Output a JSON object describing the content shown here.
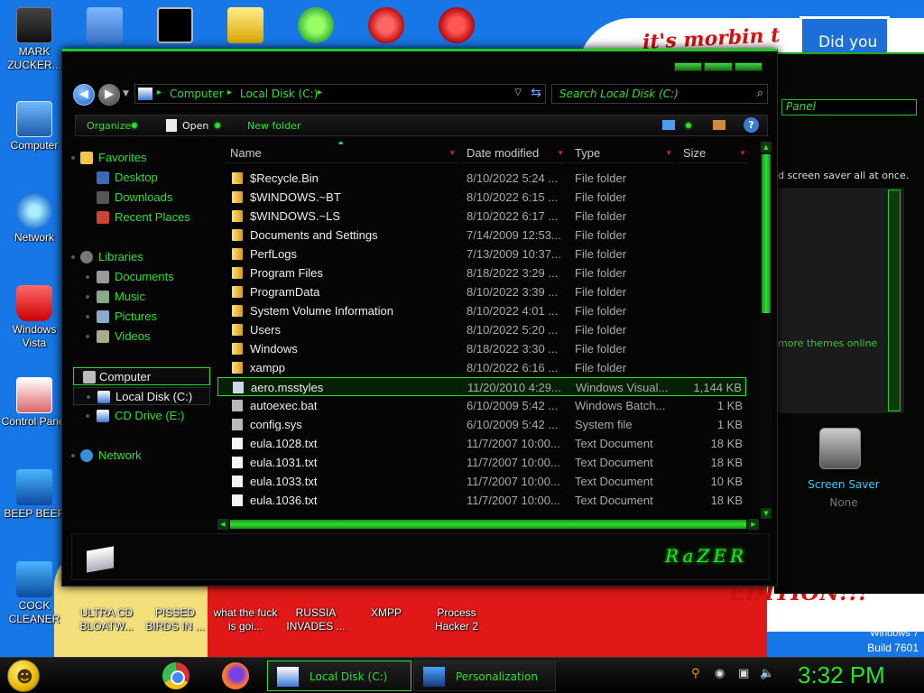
{
  "desktop": {
    "wallpaper_text_1": "it's morbin t",
    "wallpaper_text_2": "EDITION!!!",
    "wallpaper_didyou": "Did you",
    "build_line1": "Windows 7",
    "build_line2": "Build 7601",
    "icons_left": [
      {
        "label": "MARK ZUCKER..."
      },
      {
        "label": "Computer"
      },
      {
        "label": "Network"
      },
      {
        "label": "Windows Vista"
      },
      {
        "label": "Control Panel"
      },
      {
        "label": "BEEP BEEP"
      },
      {
        "label": "COCK CLEANER"
      }
    ],
    "icons_bottom": [
      {
        "label": "ULTRA CD BLOATW..."
      },
      {
        "label": "PISSED BIRDS IN ..."
      },
      {
        "label": "what the fuck is goi..."
      },
      {
        "label": "RUSSIA INVADES ..."
      },
      {
        "label": "XMPP"
      },
      {
        "label": "Process Hacker 2"
      }
    ],
    "icons_top": [
      {
        "label": "command-prompt-icon"
      },
      {
        "label": "notepad-icon"
      },
      {
        "label": "folder-icon"
      },
      {
        "label": "pissed-birds-icon"
      },
      {
        "label": "p-icon"
      },
      {
        "label": "DEV C++"
      }
    ]
  },
  "bg_window": {
    "search_text": "Panel",
    "body_text": "d screen saver all at once.",
    "link_text": "more themes online",
    "screensaver_label": "Screen Saver",
    "screensaver_value": "None"
  },
  "explorer": {
    "address": {
      "crumb1": "Computer",
      "crumb2": "Local Disk (C:)"
    },
    "search_placeholder": "Search Local Disk (C:)",
    "commands": {
      "organize": "Organize",
      "open": "Open",
      "new_folder": "New folder",
      "help": "?"
    },
    "nav": {
      "favorites": "Favorites",
      "desktop": "Desktop",
      "downloads": "Downloads",
      "recent": "Recent Places",
      "libraries": "Libraries",
      "documents": "Documents",
      "music": "Music",
      "pictures": "Pictures",
      "videos": "Videos",
      "computer": "Computer",
      "local_disk": "Local Disk (C:)",
      "cd_drive": "CD Drive (E:)",
      "network": "Network"
    },
    "columns": {
      "name": "Name",
      "date": "Date modified",
      "type": "Type",
      "size": "Size"
    },
    "files": [
      {
        "name": "$Recycle.Bin",
        "date": "8/10/2022 5:24 ...",
        "type": "File folder",
        "size": "",
        "kind": "folder"
      },
      {
        "name": "$WINDOWS.~BT",
        "date": "8/10/2022 6:15 ...",
        "type": "File folder",
        "size": "",
        "kind": "folder"
      },
      {
        "name": "$WINDOWS.~LS",
        "date": "8/10/2022 6:17 ...",
        "type": "File folder",
        "size": "",
        "kind": "folder"
      },
      {
        "name": "Documents and Settings",
        "date": "7/14/2009 12:53...",
        "type": "File folder",
        "size": "",
        "kind": "folder"
      },
      {
        "name": "PerfLogs",
        "date": "7/13/2009 10:37...",
        "type": "File folder",
        "size": "",
        "kind": "folder"
      },
      {
        "name": "Program Files",
        "date": "8/18/2022 3:29 ...",
        "type": "File folder",
        "size": "",
        "kind": "folder"
      },
      {
        "name": "ProgramData",
        "date": "8/10/2022 3:39 ...",
        "type": "File folder",
        "size": "",
        "kind": "folder"
      },
      {
        "name": "System Volume Information",
        "date": "8/10/2022 4:01 ...",
        "type": "File folder",
        "size": "",
        "kind": "folder"
      },
      {
        "name": "Users",
        "date": "8/10/2022 5:20 ...",
        "type": "File folder",
        "size": "",
        "kind": "folder"
      },
      {
        "name": "Windows",
        "date": "8/18/2022 3:30 ...",
        "type": "File folder",
        "size": "",
        "kind": "folder"
      },
      {
        "name": "xampp",
        "date": "8/10/2022 6:16 ...",
        "type": "File folder",
        "size": "",
        "kind": "folder"
      },
      {
        "name": "aero.msstyles",
        "date": "11/20/2010 4:29...",
        "type": "Windows Visual...",
        "size": "1,144 KB",
        "kind": "sty"
      },
      {
        "name": "autoexec.bat",
        "date": "6/10/2009 5:42 ...",
        "type": "Windows Batch...",
        "size": "1 KB",
        "kind": "sys"
      },
      {
        "name": "config.sys",
        "date": "6/10/2009 5:42 ...",
        "type": "System file",
        "size": "1 KB",
        "kind": "sys"
      },
      {
        "name": "eula.1028.txt",
        "date": "11/7/2007 10:00...",
        "type": "Text Document",
        "size": "18 KB",
        "kind": "doc"
      },
      {
        "name": "eula.1031.txt",
        "date": "11/7/2007 10:00...",
        "type": "Text Document",
        "size": "18 KB",
        "kind": "doc"
      },
      {
        "name": "eula.1033.txt",
        "date": "11/7/2007 10:00...",
        "type": "Text Document",
        "size": "10 KB",
        "kind": "doc"
      },
      {
        "name": "eula.1036.txt",
        "date": "11/7/2007 10:00...",
        "type": "Text Document",
        "size": "18 KB",
        "kind": "doc"
      }
    ],
    "logo": "RaZER"
  },
  "taskbar": {
    "tasks": [
      {
        "label": "Local Disk (C:)"
      },
      {
        "label": "Personalization"
      }
    ],
    "clock": "3:32 PM"
  }
}
